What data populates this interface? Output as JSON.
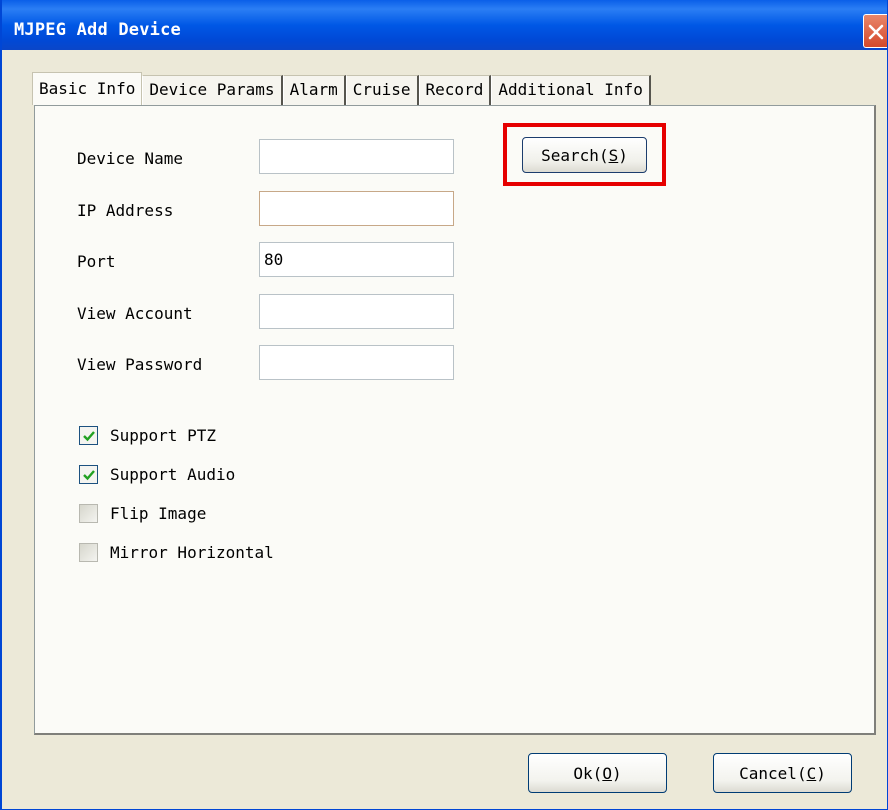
{
  "window": {
    "title": "MJPEG Add Device"
  },
  "tabs": [
    {
      "label": "Basic Info",
      "active": true
    },
    {
      "label": "Device Params",
      "active": false
    },
    {
      "label": "Alarm",
      "active": false
    },
    {
      "label": "Cruise",
      "active": false
    },
    {
      "label": "Record",
      "active": false
    },
    {
      "label": "Additional Info",
      "active": false
    }
  ],
  "form": {
    "device_name": {
      "label": "Device Name",
      "value": ""
    },
    "ip_address": {
      "label": "IP Address",
      "value": ""
    },
    "port": {
      "label": "Port",
      "value": "80"
    },
    "view_account": {
      "label": "View Account",
      "value": ""
    },
    "view_password": {
      "label": "View Password",
      "value": ""
    }
  },
  "search_button": {
    "label": "Search(",
    "mnemonic": "S",
    "suffix": ")"
  },
  "checkboxes": [
    {
      "label": "Support PTZ",
      "checked": true
    },
    {
      "label": "Support Audio",
      "checked": true
    },
    {
      "label": "Flip Image",
      "checked": false
    },
    {
      "label": "Mirror Horizontal",
      "checked": false
    }
  ],
  "buttons": {
    "ok": {
      "label": "Ok(",
      "mnemonic": "O",
      "suffix": ")"
    },
    "cancel": {
      "label": "Cancel(",
      "mnemonic": "C",
      "suffix": ")"
    }
  },
  "colors": {
    "title_bar": "#0058e6",
    "highlight_box": "#e60000",
    "check_mark": "#21a121"
  },
  "icons": {
    "close": "close-icon",
    "check": "check-icon"
  }
}
